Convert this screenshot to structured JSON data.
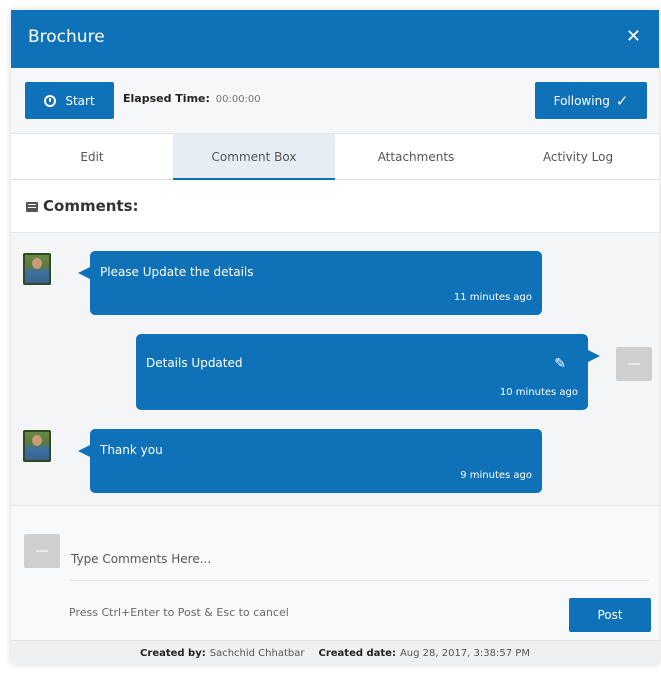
{
  "header": {
    "title": "Brochure",
    "close_icon": "close-icon",
    "accent": "#0f72b8"
  },
  "toolbar": {
    "start_label": "Start",
    "start_icon": "clock-icon",
    "elapsed_label": "Elapsed Time:",
    "elapsed_value": "00:00:00",
    "following_label": "Following",
    "following_icon": "check-icon"
  },
  "tabs": [
    {
      "label": "Edit",
      "active": false
    },
    {
      "label": "Comment Box",
      "active": true
    },
    {
      "label": "Attachments",
      "active": false
    },
    {
      "label": "Activity Log",
      "active": false
    }
  ],
  "comments": {
    "heading": "Comments:",
    "heading_icon": "comment-icon",
    "items": [
      {
        "text": "Please Update the details",
        "time": "11 minutes ago",
        "side": "left"
      },
      {
        "text": "Details Updated",
        "time": "10 minutes ago",
        "side": "right",
        "editable": true
      },
      {
        "text": "Thank you",
        "time": "9 minutes ago",
        "side": "left"
      }
    ]
  },
  "composer": {
    "placeholder": "Type Comments Here...",
    "hint": "Press Ctrl+Enter to Post & Esc to cancel",
    "post_label": "Post"
  },
  "footer": {
    "created_by_label": "Created by:",
    "created_by_value": "Sachchid Chhatbar",
    "created_date_label": "Created date:",
    "created_date_value": "Aug 28, 2017, 3:38:57 PM"
  }
}
